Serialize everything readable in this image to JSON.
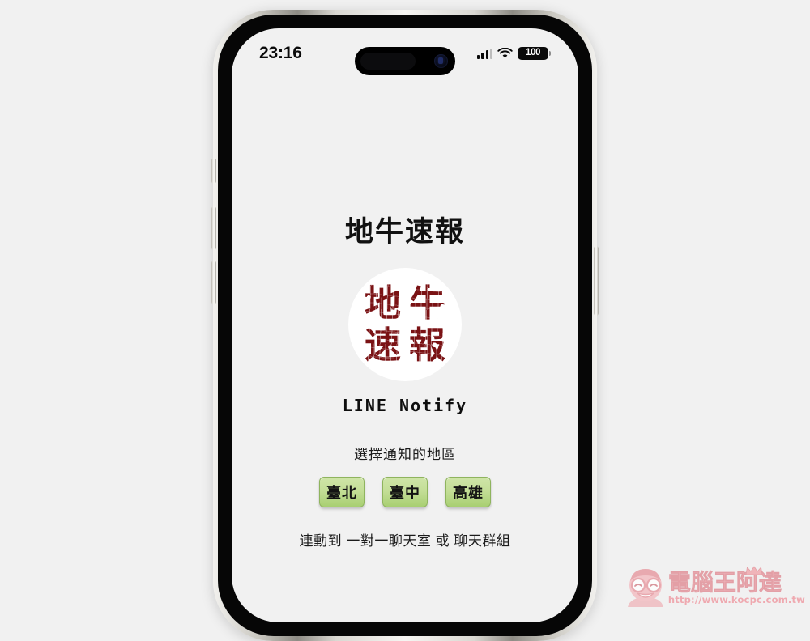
{
  "device": {
    "name": "iphone-mockup",
    "frame_color": "#dad8d2",
    "bezel_color": "#060606",
    "screen_bg": "#f1f1f1"
  },
  "status_bar": {
    "time": "23:16",
    "cellular_icon": "cellular-bars-icon",
    "wifi_icon": "wifi-icon",
    "battery": {
      "level_text": "100",
      "icon": "battery-icon"
    }
  },
  "dynamic_island": {
    "speaker_icon": "speaker-slot-icon",
    "camera_icon": "front-camera-icon"
  },
  "app": {
    "title": "地牛速報",
    "logo": {
      "icon": "earthquake-alert-logo",
      "glyphs": [
        "地",
        "牛",
        "速",
        "報"
      ],
      "color": "#7a1214",
      "bg": "#ffffff"
    },
    "service_label": "LINE Notify",
    "region_prompt": "選擇通知的地區",
    "region_buttons": [
      {
        "label": "臺北",
        "name": "region-button-taipei"
      },
      {
        "label": "臺中",
        "name": "region-button-taichung"
      },
      {
        "label": "高雄",
        "name": "region-button-kaohsiung"
      }
    ],
    "link_hint": "連動到  一對一聊天室  或  聊天群組",
    "button_color": "#c4de97"
  },
  "hardware": {
    "action_button": "action-button",
    "volume_up": "volume-up-button",
    "volume_down": "volume-down-button",
    "power_button": "power-button"
  },
  "watermark": {
    "brand": "電腦王阿達",
    "url": "http://www.kocpc.com.tw",
    "color": "#f0a7ad"
  }
}
